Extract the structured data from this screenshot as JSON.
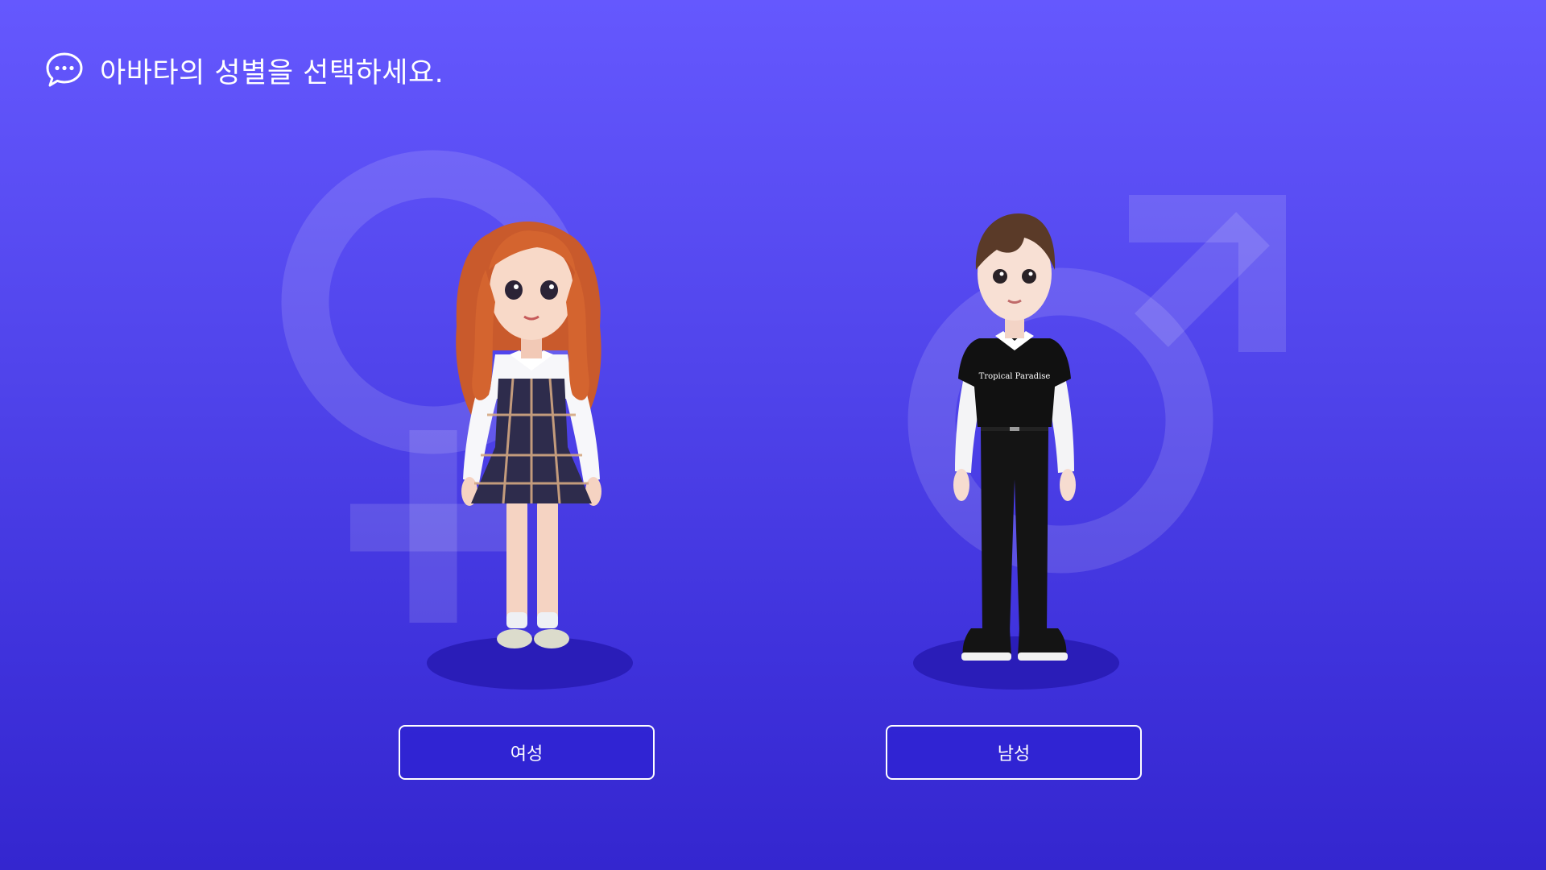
{
  "header": {
    "icon": "chat-bubble-icon",
    "title": "아바타의 성별을 선택하세요."
  },
  "options": [
    {
      "id": "female",
      "label": "여성",
      "symbol": "female-symbol-icon"
    },
    {
      "id": "male",
      "label": "남성",
      "symbol": "male-symbol-icon"
    }
  ],
  "avatar_male": {
    "shirt_text": "Tropical Paradise"
  },
  "colors": {
    "background_top": "#6558fe",
    "background_bottom": "#3426cf",
    "platform": "#2a1db8",
    "button_border": "#ffffff",
    "text": "#ffffff"
  }
}
